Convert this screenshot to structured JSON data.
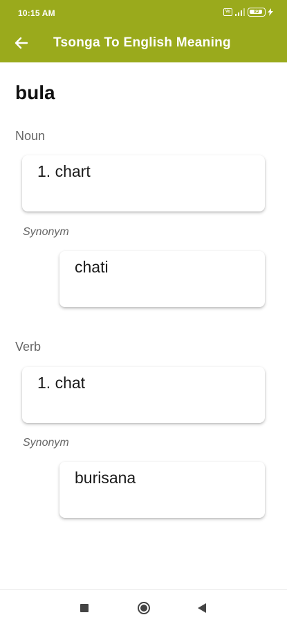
{
  "status_bar": {
    "time": "10:15 AM",
    "network_badge": "Vo",
    "battery_level": "82",
    "icons": [
      "vo-lte-icon",
      "signal-icon",
      "battery-icon",
      "charging-bolt-icon"
    ]
  },
  "app_bar": {
    "title": "Tsonga To English Meaning",
    "back_icon": "arrow-left-icon",
    "background_color": "#9aaa1c"
  },
  "entry": {
    "word": "bula",
    "sections": [
      {
        "part_of_speech": "Noun",
        "meanings": [
          "1. chart"
        ],
        "synonym_label": "Synonym",
        "synonyms": [
          "chati"
        ]
      },
      {
        "part_of_speech": "Verb",
        "meanings": [
          "1. chat"
        ],
        "synonym_label": "Synonym",
        "synonyms": [
          "burisana"
        ]
      }
    ]
  },
  "nav_bar": {
    "icons": [
      "recents-square-icon",
      "home-circle-icon",
      "back-triangle-icon"
    ]
  }
}
